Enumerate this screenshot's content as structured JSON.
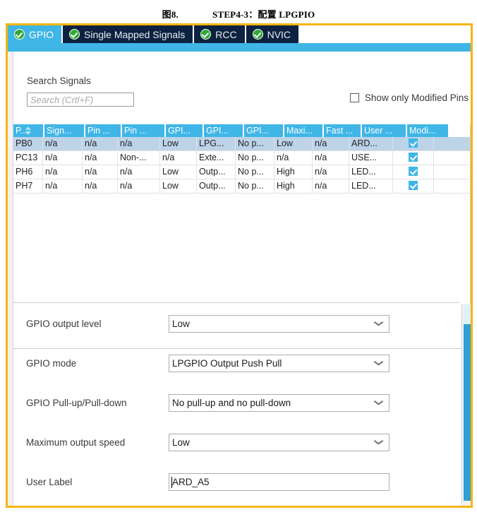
{
  "caption": {
    "number": "图8.",
    "text": "STEP4-3：配置 LPGPIO"
  },
  "colors": {
    "frame": "#f6b511",
    "tab_active_bg": "#3fb6e6",
    "tab_inactive_bg": "#0d2240",
    "header_bg": "#3fb6e6",
    "row_selected_bg": "#bdd3e8",
    "check_green": "#2eaa34",
    "scrollbar": "#2f9fd6"
  },
  "tabs": [
    {
      "label": "GPIO",
      "icon": "check-circle-icon",
      "active": true
    },
    {
      "label": "Single Mapped Signals",
      "icon": "check-circle-icon",
      "active": false
    },
    {
      "label": "RCC",
      "icon": "check-circle-icon",
      "active": false
    },
    {
      "label": "NVIC",
      "icon": "check-circle-icon",
      "active": false
    }
  ],
  "search": {
    "label": "Search Signals",
    "placeholder": "Search (Crtl+F)",
    "value": ""
  },
  "filter": {
    "modified_pins_label": "Show only Modified Pins",
    "modified_pins_checked": false
  },
  "table": {
    "columns": [
      {
        "label": "P...",
        "width": 42,
        "sorted": true
      },
      {
        "label": "Sign...",
        "width": 56,
        "sorted": false
      },
      {
        "label": "Pin ...",
        "width": 50,
        "sorted": false
      },
      {
        "label": "Pin ...",
        "width": 60,
        "sorted": false
      },
      {
        "label": "GPI...",
        "width": 52,
        "sorted": false
      },
      {
        "label": "GPI...",
        "width": 55,
        "sorted": false
      },
      {
        "label": "GPI...",
        "width": 55,
        "sorted": false
      },
      {
        "label": "Maxi...",
        "width": 54,
        "sorted": false
      },
      {
        "label": "Fast ...",
        "width": 52,
        "sorted": false
      },
      {
        "label": "User ...",
        "width": 62,
        "sorted": false
      },
      {
        "label": "Modi...",
        "width": 58,
        "sorted": false
      }
    ],
    "rows": [
      {
        "selected": true,
        "cells": [
          "PB0",
          "n/a",
          "n/a",
          "n/a",
          "Low",
          "LPG...",
          "No p...",
          "Low",
          "n/a",
          "ARD..."
        ],
        "modified": true
      },
      {
        "selected": false,
        "cells": [
          "PC13",
          "n/a",
          "n/a",
          "Non-...",
          "n/a",
          "Exte...",
          "No p...",
          "n/a",
          "n/a",
          "USE..."
        ],
        "modified": true
      },
      {
        "selected": false,
        "cells": [
          "PH6",
          "n/a",
          "n/a",
          "n/a",
          "Low",
          "Outp...",
          "No p...",
          "High",
          "n/a",
          "LED..."
        ],
        "modified": true
      },
      {
        "selected": false,
        "cells": [
          "PH7",
          "n/a",
          "n/a",
          "n/a",
          "Low",
          "Outp...",
          "No p...",
          "High",
          "n/a",
          "LED..."
        ],
        "modified": true
      }
    ]
  },
  "form": {
    "fields": [
      {
        "label": "GPIO output level",
        "value": "Low",
        "type": "select"
      },
      {
        "label": "GPIO mode",
        "value": "LPGPIO Output Push Pull",
        "type": "select"
      },
      {
        "label": "GPIO Pull-up/Pull-down",
        "value": "No pull-up and no pull-down",
        "type": "select"
      },
      {
        "label": "Maximum output speed",
        "value": "Low",
        "type": "select"
      },
      {
        "label": "User Label",
        "value": "ARD_A5",
        "type": "text"
      }
    ]
  }
}
